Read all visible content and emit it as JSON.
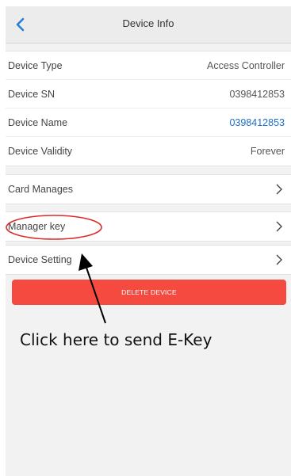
{
  "header": {
    "title": "Device Info",
    "back_icon": "chevron-left-icon"
  },
  "device_info": [
    {
      "label": "Device Type",
      "value": "Access Controller",
      "link": false
    },
    {
      "label": "Device SN",
      "value": "0398412853",
      "link": false
    },
    {
      "label": "Device Name",
      "value": "0398412853",
      "link": true
    },
    {
      "label": "Device Validity",
      "value": "Forever",
      "link": false
    }
  ],
  "menu": {
    "card_manages": "Card Manages",
    "manager_key": "Manager key",
    "device_setting": "Device Setting",
    "chevron_icon": "chevron-right-icon"
  },
  "delete_button": "DELETE DEVICE",
  "annotation": {
    "text": "Click here to send E-Key"
  },
  "colors": {
    "accent": "#2a7fd4",
    "link": "#1e6fc7",
    "danger": "#f54a3f",
    "highlight_circle": "#e02a2a"
  }
}
